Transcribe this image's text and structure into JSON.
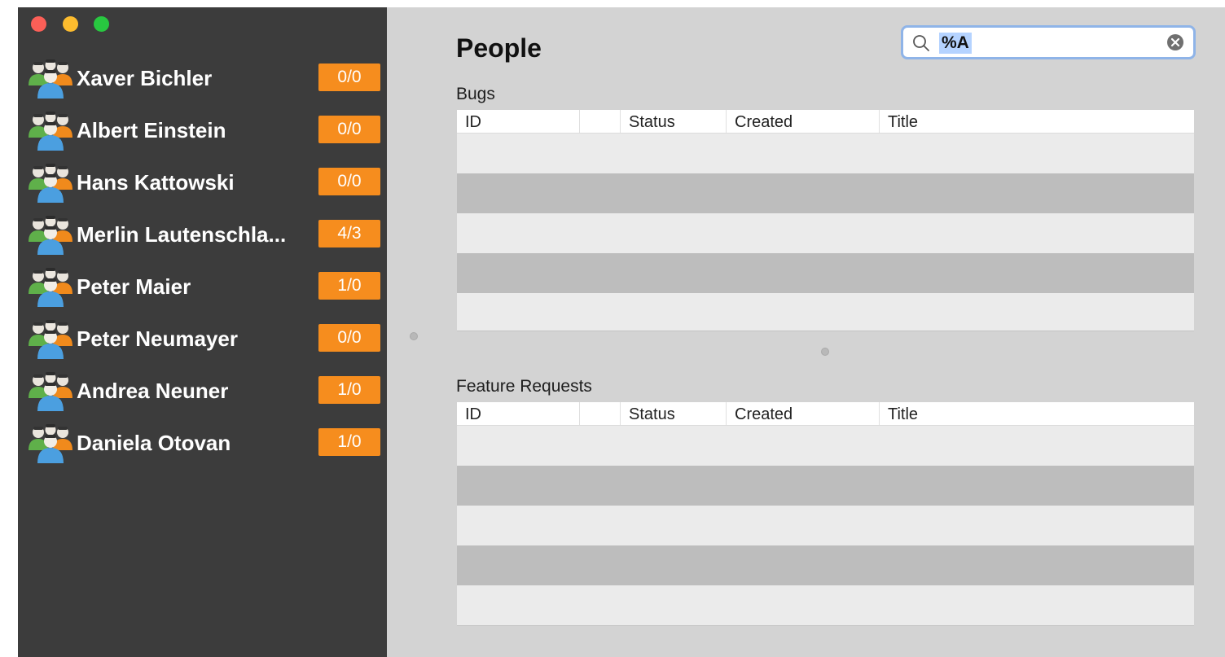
{
  "sidebar": {
    "people": [
      {
        "name": "Xaver Bichler",
        "count": "0/0"
      },
      {
        "name": "Albert Einstein",
        "count": "0/0"
      },
      {
        "name": "Hans Kattowski",
        "count": "0/0"
      },
      {
        "name": "Merlin Lautenschla...",
        "count": "4/3"
      },
      {
        "name": "Peter Maier",
        "count": "1/0"
      },
      {
        "name": "Peter Neumayer",
        "count": "0/0"
      },
      {
        "name": "Andrea Neuner",
        "count": "1/0"
      },
      {
        "name": "Daniela Otovan",
        "count": "1/0"
      }
    ],
    "icon": "people-group-icon"
  },
  "header": {
    "title": "People"
  },
  "search": {
    "value": "%A",
    "icons": [
      "search-icon",
      "clear-icon"
    ]
  },
  "bugs": {
    "label": "Bugs",
    "columns": [
      "ID",
      "",
      "Status",
      "Created",
      "Title"
    ]
  },
  "feature_requests": {
    "label": "Feature Requests",
    "columns": [
      "ID",
      "",
      "Status",
      "Created",
      "Title"
    ]
  },
  "colors": {
    "sidebar_bg": "#3c3c3c",
    "badge": "#f68d1e",
    "content_bg": "#d3d3d3",
    "row_dark": "#bdbdbd",
    "row_light": "#ebebeb",
    "search_focus": "#8fb4e8"
  }
}
